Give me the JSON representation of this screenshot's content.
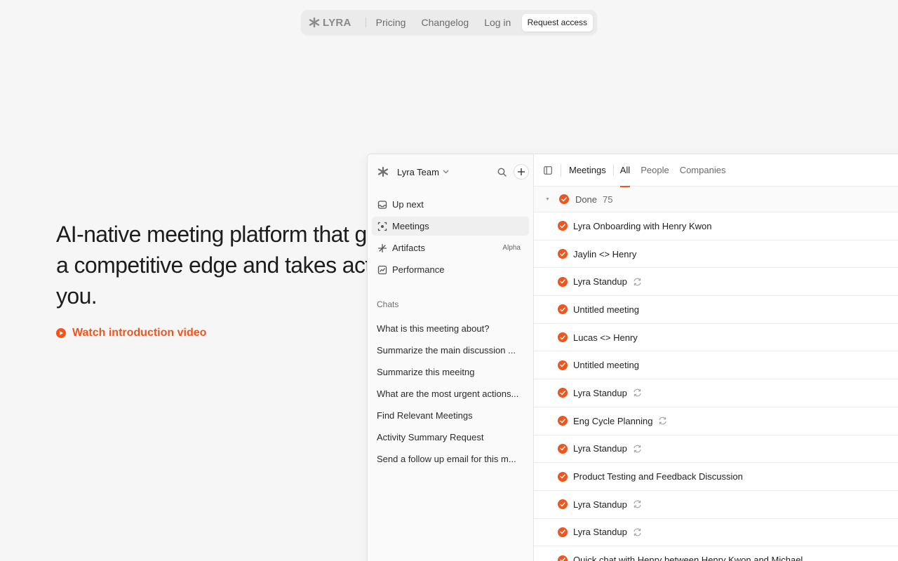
{
  "topnav": {
    "brand": "LYRA",
    "links": [
      "Pricing",
      "Changelog",
      "Log in"
    ],
    "cta": "Request access"
  },
  "hero": {
    "title": "AI-native meeting platform that gives you a competitive edge and takes action for you.",
    "watch_label": "Watch introduction video"
  },
  "sidebar": {
    "workspace": "Lyra Team",
    "nav": [
      {
        "label": "Up next",
        "icon": "inbox-icon"
      },
      {
        "label": "Meetings",
        "icon": "meetings-icon",
        "active": true
      },
      {
        "label": "Artifacts",
        "icon": "artifacts-icon",
        "badge": "Alpha"
      },
      {
        "label": "Performance",
        "icon": "performance-icon"
      }
    ],
    "chats_label": "Chats",
    "chats": [
      "What is this meeting about?",
      "Summarize the main discussion ...",
      "Summarize this meeitng",
      "What are the most urgent actions...",
      "Find Relevant Meetings",
      "Activity Summary Request",
      "Send a follow up email for this m..."
    ]
  },
  "main": {
    "section": "Meetings",
    "tabs": [
      "All",
      "People",
      "Companies"
    ],
    "active_tab": "All",
    "group": {
      "label": "Done",
      "count": "75"
    },
    "meetings": [
      {
        "title": "Lyra Onboarding with Henry Kwon",
        "recurring": false
      },
      {
        "title": "Jaylin <> Henry",
        "recurring": false
      },
      {
        "title": "Lyra Standup",
        "recurring": true
      },
      {
        "title": "Untitled meeting",
        "recurring": false
      },
      {
        "title": "Lucas <> Henry",
        "recurring": false
      },
      {
        "title": "Untitled meeting",
        "recurring": false
      },
      {
        "title": "Lyra Standup",
        "recurring": true
      },
      {
        "title": "Eng Cycle Planning",
        "recurring": true
      },
      {
        "title": "Lyra Standup",
        "recurring": true
      },
      {
        "title": "Product Testing and Feedback Discussion",
        "recurring": false
      },
      {
        "title": "Lyra Standup",
        "recurring": true
      },
      {
        "title": "Lyra Standup",
        "recurring": true
      },
      {
        "title": "Quick chat with Henry between Henry Kwon and Michael",
        "recurring": false
      }
    ]
  },
  "colors": {
    "accent": "#f0551e",
    "background": "#f6f6f6"
  }
}
